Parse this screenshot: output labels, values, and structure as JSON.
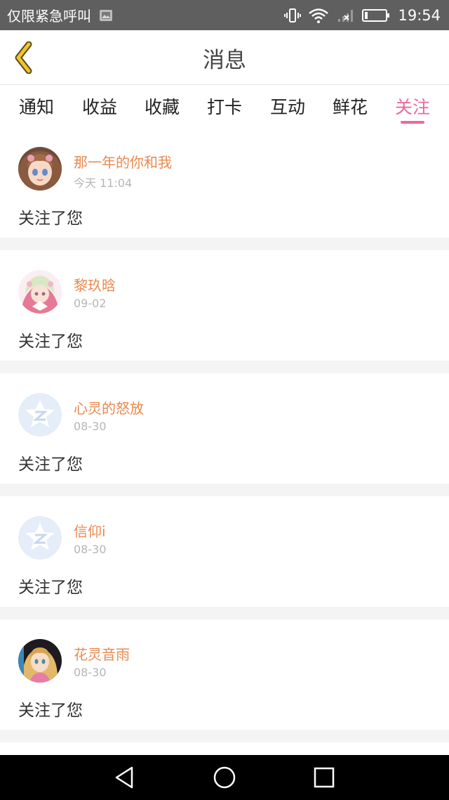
{
  "status_bar": {
    "carrier": "仅限紧急呼叫",
    "time": "19:54",
    "icons": [
      "image-notification-icon",
      "vibrate-icon",
      "wifi-icon",
      "no-signal-icon",
      "battery-icon"
    ]
  },
  "header": {
    "title": "消息",
    "back_icon": "chevron-left-icon"
  },
  "tabs": [
    {
      "label": "通知",
      "active": false
    },
    {
      "label": "收益",
      "active": false
    },
    {
      "label": "收藏",
      "active": false
    },
    {
      "label": "打卡",
      "active": false
    },
    {
      "label": "互动",
      "active": false
    },
    {
      "label": "鲜花",
      "active": false
    },
    {
      "label": "关注",
      "active": true
    }
  ],
  "messages": [
    {
      "name": "那一年的你和我",
      "date": "今天 11:04",
      "text": "关注了您",
      "avatar": "anime-girl-avatar"
    },
    {
      "name": "黎玖晗",
      "date": "09-02",
      "text": "关注了您",
      "avatar": "anime-girl-pink-avatar"
    },
    {
      "name": "心灵的怒放",
      "date": "08-30",
      "text": "关注了您",
      "avatar": "default-qzone-avatar"
    },
    {
      "name": "信仰i",
      "date": "08-30",
      "text": "关注了您",
      "avatar": "default-qzone-avatar"
    },
    {
      "name": "花灵音雨",
      "date": "08-30",
      "text": "关注了您",
      "avatar": "anime-girl-blonde-avatar"
    }
  ],
  "colors": {
    "accent": "#e96b9e",
    "name": "#e9894f",
    "back_icon": "#f3c32c",
    "status_bar": "#5f5f5f",
    "nav_bar": "#000000"
  },
  "nav_bar": {
    "buttons": [
      "back-triangle-icon",
      "home-circle-icon",
      "recents-square-icon"
    ]
  }
}
